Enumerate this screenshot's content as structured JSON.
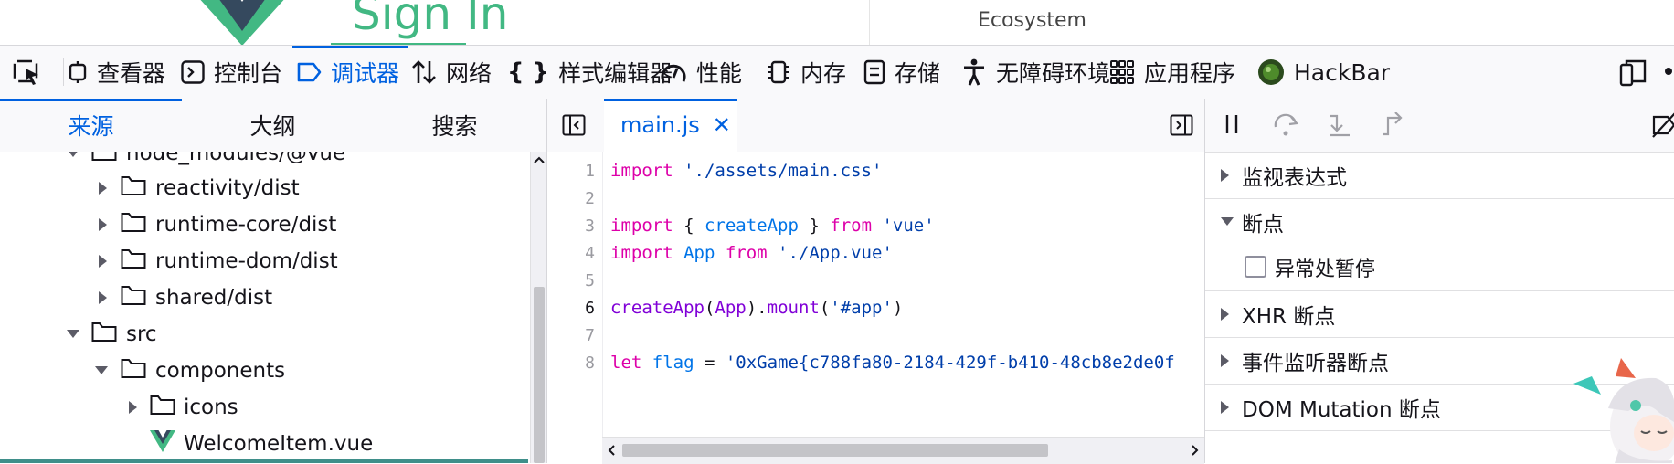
{
  "page": {
    "heading": "Sign In",
    "nav_link": "Ecosystem"
  },
  "devtools": {
    "tabs": [
      {
        "label": "查看器",
        "icon": "inspector-icon"
      },
      {
        "label": "控制台",
        "icon": "console-icon"
      },
      {
        "label": "调试器",
        "icon": "debugger-icon",
        "active": true
      },
      {
        "label": "网络",
        "icon": "network-icon"
      },
      {
        "label": "样式编辑器",
        "icon": "style-editor-icon"
      },
      {
        "label": "性能",
        "icon": "performance-icon"
      },
      {
        "label": "内存",
        "icon": "memory-icon"
      },
      {
        "label": "存储",
        "icon": "storage-icon"
      },
      {
        "label": "无障碍环境",
        "icon": "accessibility-icon"
      },
      {
        "label": "应用程序",
        "icon": "application-icon"
      },
      {
        "label": "HackBar",
        "icon": "hackbar-icon"
      }
    ],
    "accent_color": "#0061e0"
  },
  "sources": {
    "tabs": [
      "来源",
      "大纲",
      "搜索"
    ],
    "tree": [
      {
        "label": "node_modules/@vue",
        "expanded": true
      },
      {
        "label": "reactivity/dist",
        "expanded": false
      },
      {
        "label": "runtime-core/dist",
        "expanded": false
      },
      {
        "label": "runtime-dom/dist",
        "expanded": false
      },
      {
        "label": "shared/dist",
        "expanded": false
      },
      {
        "label": "src",
        "expanded": true
      },
      {
        "label": "components",
        "expanded": true
      },
      {
        "label": "icons",
        "expanded": false
      },
      {
        "label": "WelcomeItem.vue",
        "type": "vue-file"
      }
    ]
  },
  "editor": {
    "file_tab": "main.js",
    "close_glyph": "✕",
    "line_numbers": [
      "1",
      "2",
      "3",
      "4",
      "5",
      "6",
      "7",
      "8"
    ],
    "lines": {
      "l1": {
        "kw": "import",
        "str": " './assets/main.css'"
      },
      "l3": {
        "kw": "import",
        "p1": " { ",
        "fn": "createApp",
        "p2": " } ",
        "kw2": "from",
        "str": " 'vue'"
      },
      "l4": {
        "kw": "import",
        "id": " App ",
        "kw2": "from",
        "str": " './App.vue'"
      },
      "l6": {
        "fn": "createApp",
        "p1": "(",
        "id": "App",
        "p2": ").",
        "fn2": "mount",
        "p3": "(",
        "str": "'#app'",
        "p4": ")"
      },
      "l8": {
        "kw": "let",
        "id": " flag",
        "op": " = ",
        "str": "'0xGame{c788fa80-2184-429f-b410-48cb8e2de0f"
      }
    }
  },
  "debug_panel": {
    "watch": "监视表达式",
    "breakpoints": "断点",
    "pause_on_exceptions": "异常处暂停",
    "xhr_breakpoints": "XHR 断点",
    "event_listener_breakpoints": "事件监听器断点",
    "dom_mutation_breakpoints": "DOM Mutation 断点"
  }
}
